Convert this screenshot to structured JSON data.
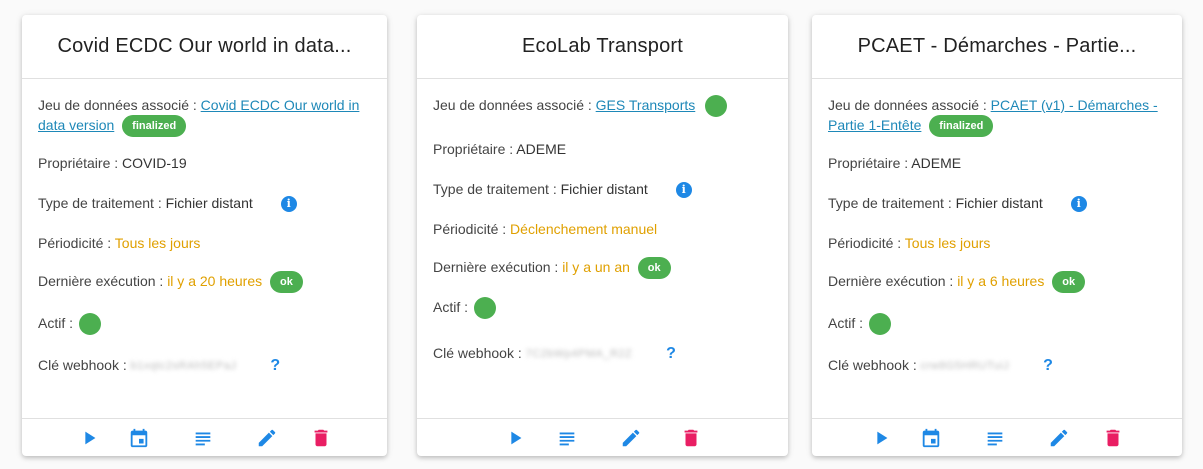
{
  "cards": [
    {
      "title": "Covid ECDC Our world in data...",
      "dataset_label": "Jeu de données associé :",
      "dataset_link": "Covid ECDC Our world in data version",
      "dataset_status": "finalized",
      "owner_label": "Propriétaire :",
      "owner_value": "COVID-19",
      "type_label": "Type de traitement :",
      "type_value": "Fichier distant",
      "period_label": "Périodicité :",
      "period_value": "Tous les jours",
      "last_label": "Dernière exécution :",
      "last_value": "il y a 20 heures",
      "last_status": "ok",
      "active_label": "Actif :",
      "webhook_label": "Clé webhook :",
      "webhook_value": "b1xqtc2sRAh5EPaJ",
      "help_symbol": "?"
    },
    {
      "title": "EcoLab Transport",
      "dataset_label": "Jeu de données associé :",
      "dataset_link": "GES Transports",
      "owner_label": "Propriétaire :",
      "owner_value": "ADEME",
      "type_label": "Type de traitement :",
      "type_value": "Fichier distant",
      "period_label": "Périodicité :",
      "period_value": "Déclenchement manuel",
      "last_label": "Dernière exécution :",
      "last_value": "il y a un an",
      "last_status": "ok",
      "active_label": "Actif :",
      "webhook_label": "Clé webhook :",
      "webhook_value": "7C2bWp4PMA_R2Z",
      "help_symbol": "?"
    },
    {
      "title": "PCAET - Démarches - Partie...",
      "dataset_label": "Jeu de données associé :",
      "dataset_link": "PCAET (v1) - Démarches - Partie 1-Entête",
      "dataset_status": "finalized",
      "owner_label": "Propriétaire :",
      "owner_value": "ADEME",
      "type_label": "Type de traitement :",
      "type_value": "Fichier distant",
      "period_label": "Périodicité :",
      "period_value": "Tous les jours",
      "last_label": "Dernière exécution :",
      "last_value": "il y a 6 heures",
      "last_status": "ok",
      "active_label": "Actif :",
      "webhook_label": "Clé webhook :",
      "webhook_value": "crw8G5HRUTuiJ",
      "help_symbol": "?"
    }
  ],
  "colors": {
    "accent": "#1e88e5",
    "success": "#4caf50",
    "warning": "#e0a000",
    "danger": "#e91e63",
    "link": "#1e88b8"
  },
  "icons": {
    "run": "play-icon",
    "schedule": "calendar-icon",
    "logs": "list-icon",
    "edit": "pencil-icon",
    "delete": "trash-icon",
    "info": "info-icon",
    "help": "help-icon"
  }
}
